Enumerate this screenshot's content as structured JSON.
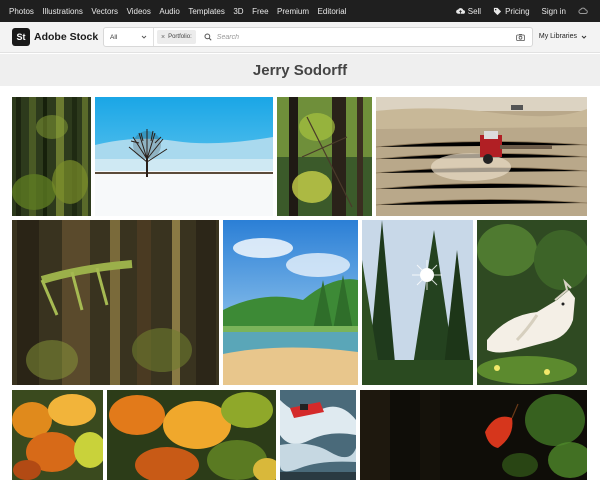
{
  "topnav": {
    "links": [
      "Photos",
      "Illustrations",
      "Vectors",
      "Videos",
      "Audio",
      "Templates",
      "3D",
      "Free",
      "Premium",
      "Editorial"
    ],
    "sell": "Sell",
    "pricing": "Pricing",
    "signin": "Sign in"
  },
  "header": {
    "logo_badge": "St",
    "logo_text": "Adobe Stock",
    "filter_value": "All",
    "chip_label": "Portfolio:",
    "search_placeholder": "Search",
    "libraries": "My Libraries"
  },
  "page": {
    "title": "Jerry Sodorff"
  },
  "colors": {
    "nav_bg": "#1f1f1f",
    "header_bg": "#f3f3f3",
    "title_bg": "#efefef"
  }
}
